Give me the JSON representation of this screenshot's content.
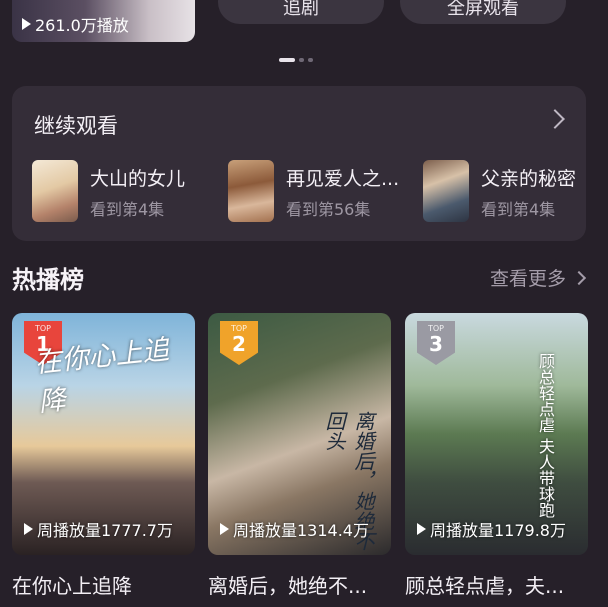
{
  "banner": {
    "play_count": "261.0万播放",
    "left_pill_label": "追剧",
    "right_pill_label": "全屏观看"
  },
  "continue_watching": {
    "title": "继续观看",
    "items": [
      {
        "name": "大山的女儿",
        "progress": "看到第4集"
      },
      {
        "name": "再见爱人之...",
        "progress": "看到第56集"
      },
      {
        "name": "父亲的秘密",
        "progress": "看到第4集"
      }
    ]
  },
  "hot_list": {
    "title": "热播榜",
    "see_more": "查看更多",
    "badge_label": "TOP",
    "items": [
      {
        "rank": "1",
        "poster_title": "在你心上追降",
        "weekly_plays": "周播放量1777.7万",
        "name": "在你心上追降",
        "badge_color": "#e8453c"
      },
      {
        "rank": "2",
        "poster_title": "离婚后，她绝不回头",
        "weekly_plays": "周播放量1314.4万",
        "name": "离婚后，她绝不...",
        "badge_color": "#f0a32a"
      },
      {
        "rank": "3",
        "poster_title": "顾总轻点虐 夫人带球跑",
        "weekly_plays": "周播放量1179.8万",
        "name": "顾总轻点虐，夫...",
        "badge_color": "#9a9aa3"
      }
    ]
  }
}
